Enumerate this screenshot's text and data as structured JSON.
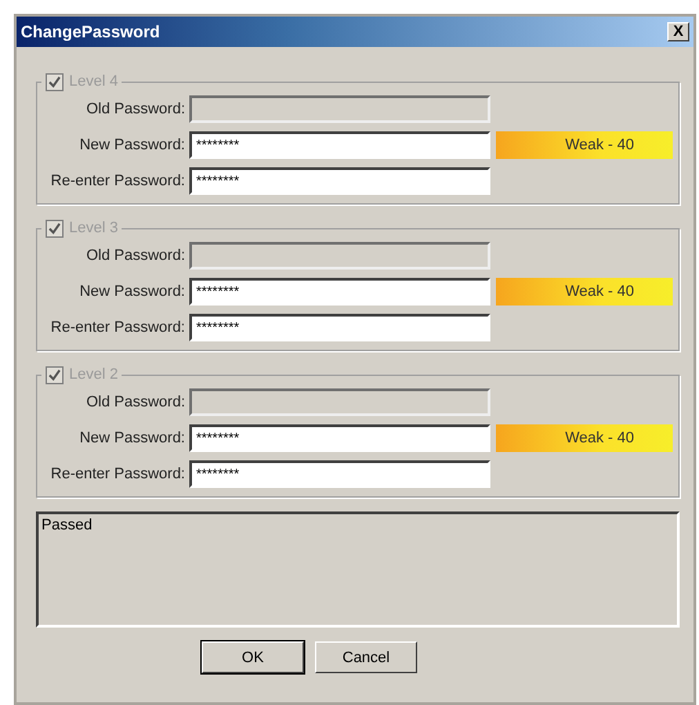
{
  "window": {
    "title": "ChangePassword",
    "close": "X"
  },
  "levels": [
    {
      "label": "Level 4",
      "checked": true,
      "disabled": true,
      "old_password": {
        "label": "Old Password:",
        "disabled": true
      },
      "new_password": {
        "label": "New Password:",
        "value": "********",
        "disabled": false
      },
      "reenter_password": {
        "label": "Re-enter Password:",
        "value": "********",
        "disabled": false
      },
      "strength": "Weak - 40"
    },
    {
      "label": "Level 3",
      "checked": true,
      "disabled": true,
      "old_password": {
        "label": "Old Password:",
        "disabled": true
      },
      "new_password": {
        "label": "New Password:",
        "value": "********",
        "disabled": false
      },
      "reenter_password": {
        "label": "Re-enter Password:",
        "value": "********",
        "disabled": false
      },
      "strength": "Weak - 40"
    },
    {
      "label": "Level 2",
      "checked": true,
      "disabled": true,
      "old_password": {
        "label": "Old Password:",
        "disabled": true
      },
      "new_password": {
        "label": "New Password:",
        "value": "********",
        "disabled": false
      },
      "reenter_password": {
        "label": "Re-enter Password:",
        "value": "********",
        "disabled": false
      },
      "strength": "Weak - 40"
    }
  ],
  "status": "Passed",
  "buttons": [
    "OK",
    "Cancel"
  ]
}
